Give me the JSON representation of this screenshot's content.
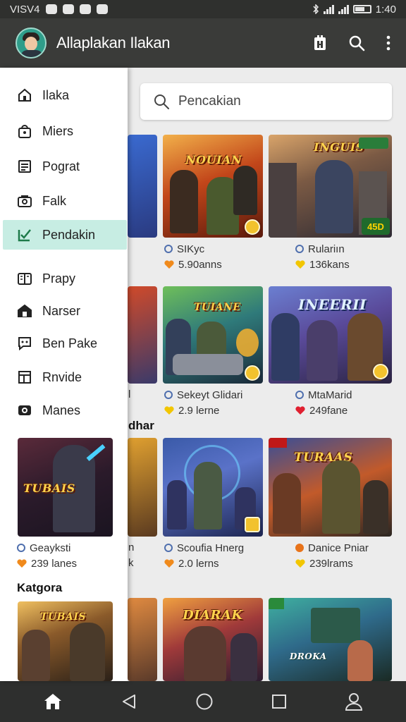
{
  "status_bar": {
    "left_text": "VISV4",
    "time": "1:40"
  },
  "app_bar": {
    "title": "Allaplakan Ilakan"
  },
  "search": {
    "placeholder": "Pencakian"
  },
  "drawer": {
    "items": [
      {
        "label": "Ilaka",
        "icon": "home-outline-icon"
      },
      {
        "label": "Miers",
        "icon": "bag-icon"
      },
      {
        "label": "Pograt",
        "icon": "document-icon"
      },
      {
        "label": "Falk",
        "icon": "folder-icon"
      },
      {
        "label": "Pendakin",
        "icon": "checkbox-icon",
        "active": true
      },
      {
        "label": "Prapy",
        "icon": "book-icon"
      },
      {
        "label": "Narser",
        "icon": "store-icon"
      },
      {
        "label": "Ben Pake",
        "icon": "chat-icon"
      },
      {
        "label": "Rnvide",
        "icon": "layout-icon"
      },
      {
        "label": "Manes",
        "icon": "eye-icon"
      }
    ],
    "game": {
      "title": "Geayksti",
      "likes": "239 lanes",
      "art_title": "TUBAIS"
    },
    "section": "Katgora"
  },
  "games": [
    {
      "title": "SIKyc",
      "likes": "5.90anns",
      "art": "NOUIAN",
      "heart": "orange"
    },
    {
      "title": "Rulariın",
      "likes": "136kans",
      "art": "INGUIS",
      "badge": "45D",
      "heart": "yellow"
    },
    {
      "title": "Sekeyt Glidari",
      "likes": "2.9 lerne",
      "art": "TUIANE",
      "heart": "yellow"
    },
    {
      "title": "MtaMarid",
      "likes": "249fane",
      "art": "INEERII",
      "heart": "red"
    },
    {
      "title": "Scoufia Hnerg",
      "likes": "2.0 lerns",
      "art": "",
      "heart": "orange"
    },
    {
      "title": "Danice Pniar",
      "likes": "239lrams",
      "art": "TURAAS",
      "heart": "yellow"
    },
    {
      "title": "",
      "likes": "",
      "art": "DIARAK"
    },
    {
      "title": "",
      "likes": "",
      "art": "DROKA"
    }
  ],
  "peek": {
    "row3_text": "l",
    "row4_text": "n",
    "row4_sub": "k"
  },
  "section_label": "dhar",
  "colors": {
    "accent": "#c7ede3",
    "app_bar": "#3a3b39",
    "status_bar": "#2f302e",
    "bottom_bar": "#2e2f2e"
  }
}
